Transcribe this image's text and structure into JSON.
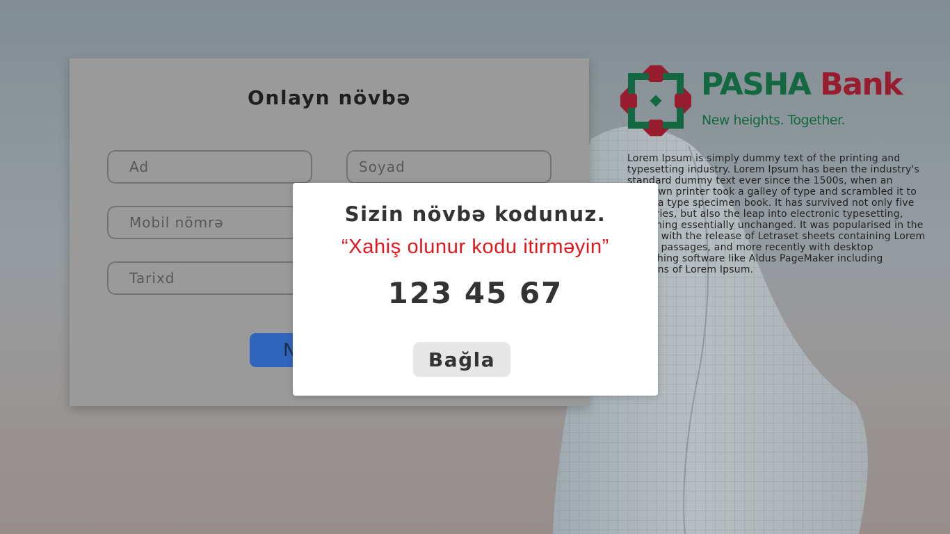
{
  "brand": {
    "name_part1": "PASHA",
    "name_part2": "Bank",
    "tagline": "New heights. Together.",
    "logo_icon": "pasha-bank-logo-icon",
    "colors": {
      "green": "#0f6f42",
      "red": "#a4182d"
    }
  },
  "info": {
    "text": "Lorem Ipsum is simply dummy text of the printing and typesetting industry. Lorem Ipsum has been the industry's standard dummy text ever since the 1500s, when an unknown printer took a galley of type and scrambled it to make a type specimen book. It has survived not only five centuries, but also the leap into electronic typesetting, remaining essentially unchanged. It was popularised in the 1960s with the release of Letraset sheets containing Lorem Ipsum passages, and more recently with desktop publishing software like Aldus PageMaker including versions of Lorem Ipsum."
  },
  "form": {
    "title": "Onlayn növbə",
    "fields": {
      "first_name": {
        "placeholder": "Ad",
        "value": ""
      },
      "last_name": {
        "placeholder": "Soyad",
        "value": ""
      },
      "mobile": {
        "placeholder": "Mobil nömrə",
        "value": ""
      },
      "date": {
        "placeholder": "Tarixd",
        "value": ""
      }
    },
    "submit_label": "N",
    "submit_color": "#2f6bd1"
  },
  "modal": {
    "title": "Sizin növbə kodunuz.",
    "warning": "“Xahiş olunur kodu itirməyin”",
    "warning_color": "#e3141b",
    "code": "123 45 67",
    "close_label": "Bağla"
  }
}
